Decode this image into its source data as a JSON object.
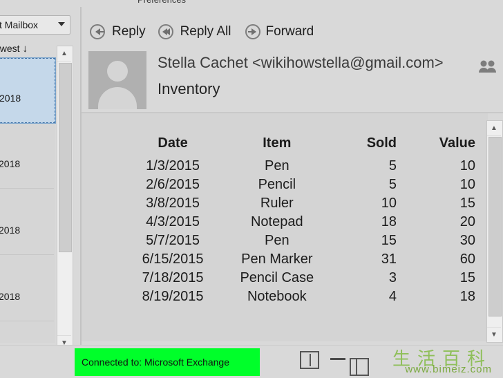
{
  "window": {
    "preferences_tab": "Preferences"
  },
  "sidebar": {
    "mailbox_selector": "t Mailbox",
    "sort_label": "ewest",
    "sort_arrow": "↓",
    "messages": [
      {
        "date": "2018",
        "selected": true
      },
      {
        "date": "2018",
        "selected": false
      },
      {
        "date": "2018",
        "selected": false
      },
      {
        "date": "2018",
        "selected": false
      }
    ],
    "scroll_up": "▲",
    "scroll_down": "▼"
  },
  "toolbar": {
    "reply": "Reply",
    "reply_all": "Reply All",
    "forward": "Forward"
  },
  "message": {
    "sender": "Stella Cachet <wikihowstella@gmail.com>",
    "subject": "Inventory"
  },
  "table": {
    "headers": [
      "Date",
      "Item",
      "Sold",
      "Value"
    ],
    "rows": [
      [
        "1/3/2015",
        "Pen",
        "5",
        "10"
      ],
      [
        "2/6/2015",
        "Pencil",
        "5",
        "10"
      ],
      [
        "3/8/2015",
        "Ruler",
        "10",
        "15"
      ],
      [
        "4/3/2015",
        "Notepad",
        "18",
        "20"
      ],
      [
        "5/7/2015",
        "Pen",
        "15",
        "30"
      ],
      [
        "6/15/2015",
        "Pen Marker",
        "31",
        "60"
      ],
      [
        "7/18/2015",
        "Pencil Case",
        "3",
        "15"
      ],
      [
        "8/19/2015",
        "Notebook",
        "4",
        "18"
      ]
    ]
  },
  "status": {
    "connection": "Connected to: Microsoft Exchange",
    "highlight_color": "#00ff2a"
  },
  "watermark": {
    "chars": "生活百科",
    "url": "www.bimeiz.com"
  }
}
